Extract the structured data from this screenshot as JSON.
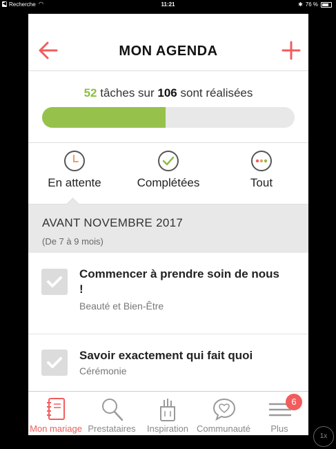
{
  "status_bar": {
    "back_app": "Recherche",
    "time": "11:21",
    "battery_percent": "76 %",
    "battery_level": 0.76
  },
  "header": {
    "title": "MON AGENDA",
    "back_icon": "arrow-left-icon",
    "add_icon": "plus-icon"
  },
  "progress": {
    "done": "52",
    "middle_text": " tâches sur ",
    "total": "106",
    "suffix": " sont réalisées",
    "fraction": 0.49
  },
  "filters": [
    {
      "label": "En attente",
      "icon": "clock-icon"
    },
    {
      "label": "Complétées",
      "icon": "check-circle-icon"
    },
    {
      "label": "Tout",
      "icon": "dots-circle-icon"
    }
  ],
  "section": {
    "title": "AVANT NOVEMBRE 2017",
    "subtitle": "(De 7 à 9 mois)"
  },
  "tasks": [
    {
      "title": "Commencer à prendre soin de nous !",
      "category": "Beauté et Bien-Être"
    },
    {
      "title": "Savoir exactement qui fait quoi",
      "category": "Cérémonie"
    }
  ],
  "tabbar": {
    "tabs": [
      {
        "label": "Mon mariage",
        "icon": "notebook-icon",
        "active": true
      },
      {
        "label": "Prestataires",
        "icon": "search-icon",
        "active": false
      },
      {
        "label": "Inspiration",
        "icon": "tools-jar-icon",
        "active": false
      },
      {
        "label": "Communauté",
        "icon": "heart-bubble-icon",
        "active": false
      },
      {
        "label": "Plus",
        "icon": "menu-icon",
        "active": false
      }
    ],
    "badge": "6"
  },
  "zoom": "1x",
  "colors": {
    "accent": "#f25c5c",
    "progress_green": "#96c24b",
    "done_green": "#8cbe3f"
  }
}
